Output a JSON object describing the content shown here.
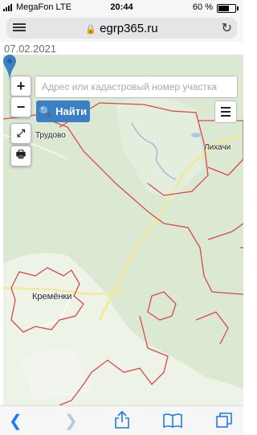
{
  "status_bar": {
    "carrier": "MegaFon",
    "network": "LTE",
    "time": "20:44",
    "battery_percent": "60 %",
    "battery_level": 0.6
  },
  "browser": {
    "url": "egrp365.ru",
    "reader_icon": "reader-mode-icon",
    "lock_icon": "lock-icon",
    "reload_icon": "reload-icon"
  },
  "page": {
    "date": "07.02.2021"
  },
  "map": {
    "zoom_in_label": "+",
    "zoom_out_label": "−",
    "search_placeholder": "Адрес или кадастровый номер участка",
    "find_button_label": "Найти",
    "places": {
      "trudovoe": "Трудово",
      "likhachi": "Лихачи",
      "kremenki": "Кремёнки"
    },
    "colors": {
      "boundary": "#d9474b",
      "forest": "#dce9d2",
      "pin": "#3b7fc4",
      "button": "#3b7fc4"
    }
  },
  "toolbar": {
    "icons": [
      "back-icon",
      "forward-icon",
      "share-icon",
      "bookmarks-icon",
      "tabs-icon"
    ],
    "accent": "#1e7cf2"
  }
}
